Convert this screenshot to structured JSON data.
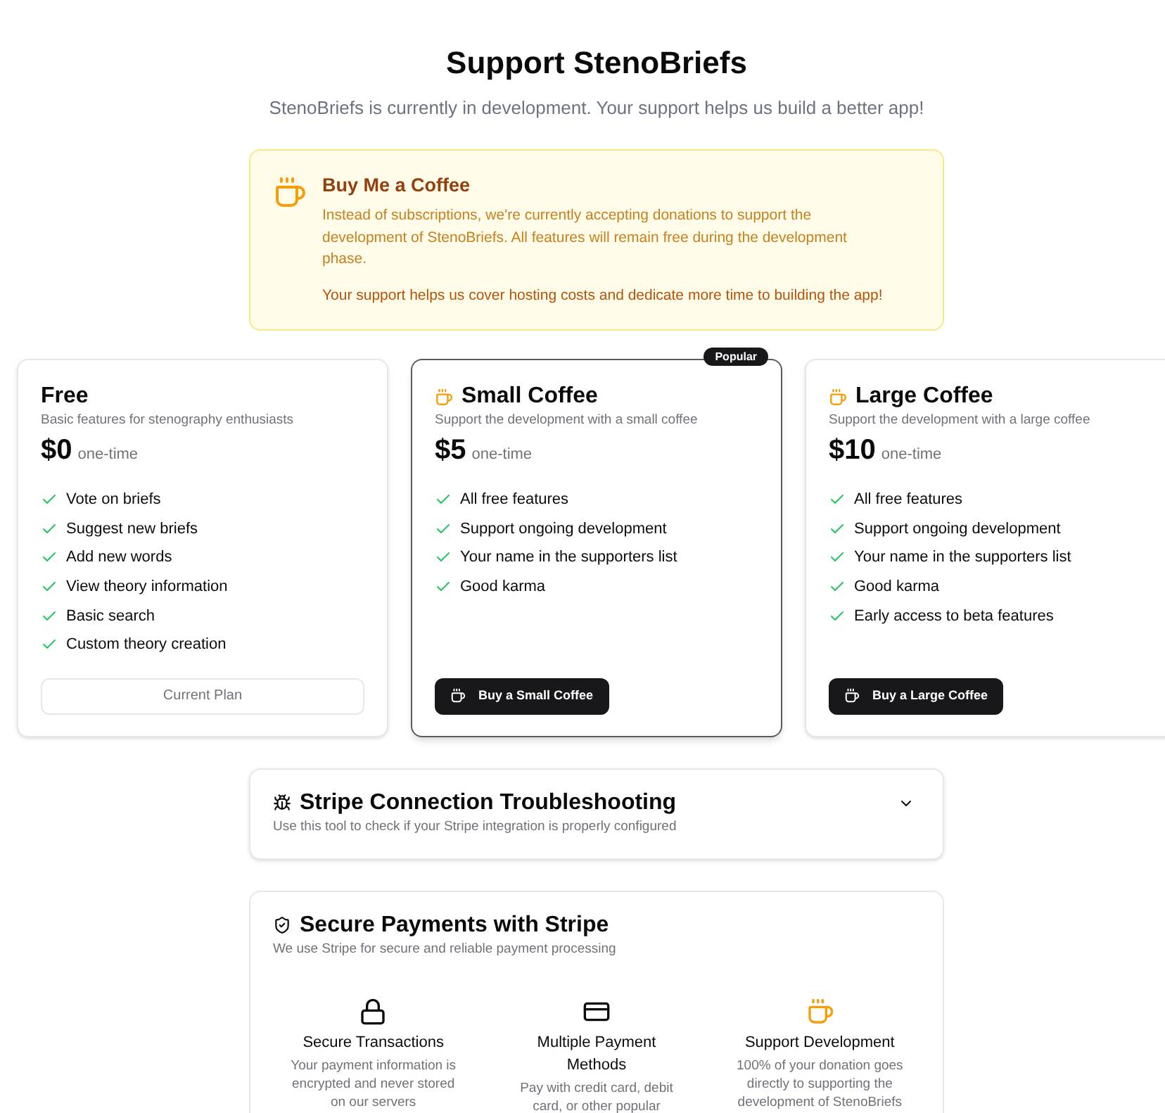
{
  "header": {
    "title": "Support StenoBriefs",
    "subtitle": "StenoBriefs is currently in development. Your support helps us build a better app!"
  },
  "notice": {
    "title": "Buy Me a Coffee",
    "paragraphs": [
      {
        "kind": "body",
        "text": "Instead of subscriptions, we're currently accepting donations to support the development of StenoBriefs. All features will remain free during the development phase."
      },
      {
        "kind": "emphasis",
        "text": "Your support helps us cover hosting costs and dedicate more time to building the app!"
      }
    ]
  },
  "plans": [
    {
      "kind": "free",
      "highlighted": false,
      "title": "Free",
      "description": "Basic features for stenography enthusiasts",
      "price": "$0",
      "period": "one-time",
      "features": [
        "Vote on briefs",
        "Suggest new briefs",
        "Add new words",
        "View theory information",
        "Basic search",
        "Custom theory creation"
      ],
      "button": {
        "kind": "current",
        "label": "Current Plan"
      }
    },
    {
      "kind": "coffee",
      "highlighted": true,
      "badge": "Popular",
      "title": "Small Coffee",
      "description": "Support the development with a small coffee",
      "price": "$5",
      "period": "one-time",
      "features": [
        "All free features",
        "Support ongoing development",
        "Your name in the supporters list",
        "Good karma"
      ],
      "button": {
        "kind": "buy",
        "label": "Buy a Small Coffee"
      }
    },
    {
      "kind": "coffee",
      "highlighted": false,
      "title": "Large Coffee",
      "description": "Support the development with a large coffee",
      "price": "$10",
      "period": "one-time",
      "features": [
        "All free features",
        "Support ongoing development",
        "Your name in the supporters list",
        "Good karma",
        "Early access to beta features"
      ],
      "button": {
        "kind": "buy",
        "label": "Buy a Large Coffee"
      }
    }
  ],
  "troubleshooting": {
    "title": "Stripe Connection Troubleshooting",
    "subtitle": "Use this tool to check if your Stripe integration is properly configured",
    "expanded": false
  },
  "secure": {
    "title": "Secure Payments with Stripe",
    "subtitle": "We use Stripe for secure and reliable payment processing",
    "features": [
      {
        "title": "Secure Transactions",
        "description": "Your payment information is encrypted and never stored on our servers"
      },
      {
        "title": "Multiple Payment Methods",
        "description": "Pay with credit card, debit card, or other popular"
      },
      {
        "title": "Support Development",
        "description": "100% of your donation goes directly to supporting the development of StenoBriefs"
      }
    ]
  }
}
